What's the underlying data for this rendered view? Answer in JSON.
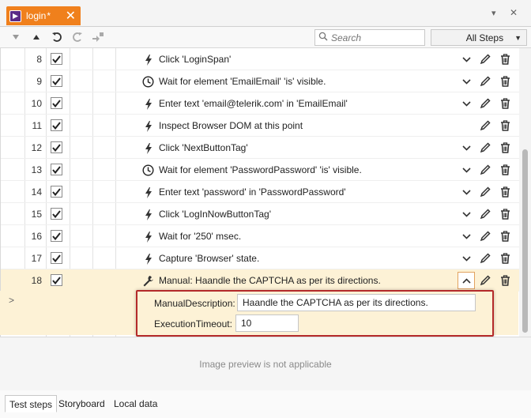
{
  "tab": {
    "title": "login",
    "modified_mark": "*"
  },
  "toolbar": {
    "search_placeholder": "Search",
    "filter_value": "All Steps"
  },
  "steps": [
    {
      "num": "8",
      "text": "Click 'LoginSpan'",
      "icon": "bolt-icon",
      "checked": true,
      "expandable": true
    },
    {
      "num": "9",
      "text": "Wait for element 'EmailEmail' 'is' visible.",
      "icon": "clock-icon",
      "checked": true,
      "expandable": true
    },
    {
      "num": "10",
      "text": "Enter text 'email@telerik.com' in 'EmailEmail'",
      "icon": "bolt-icon",
      "checked": true,
      "expandable": true
    },
    {
      "num": "11",
      "text": "Inspect Browser DOM at this point",
      "icon": "bolt-icon",
      "checked": true,
      "expandable": false
    },
    {
      "num": "12",
      "text": "Click 'NextButtonTag'",
      "icon": "bolt-icon",
      "checked": true,
      "expandable": true
    },
    {
      "num": "13",
      "text": "Wait for element 'PasswordPassword' 'is' visible.",
      "icon": "clock-icon",
      "checked": true,
      "expandable": true
    },
    {
      "num": "14",
      "text": "Enter text 'password' in 'PasswordPassword'",
      "icon": "bolt-icon",
      "checked": true,
      "expandable": true
    },
    {
      "num": "15",
      "text": "Click 'LogInNowButtonTag'",
      "icon": "bolt-icon",
      "checked": true,
      "expandable": true
    },
    {
      "num": "16",
      "text": "Wait for '250' msec.",
      "icon": "bolt-icon",
      "checked": true,
      "expandable": true
    },
    {
      "num": "17",
      "text": "Capture 'Browser' state.",
      "icon": "bolt-icon",
      "checked": true,
      "expandable": true
    },
    {
      "num": "18",
      "text": "Manual: Haandle the CAPTCHA as per its directions.",
      "icon": "wrench-icon",
      "checked": true,
      "expandable": true,
      "selected": true
    }
  ],
  "details": {
    "manual_description_label": "ManualDescription:",
    "manual_description_value": "Haandle the CAPTCHA as per its directions.",
    "execution_timeout_label": "ExecutionTimeout:",
    "execution_timeout_value": "10"
  },
  "preview": {
    "message": "Image preview is not applicable"
  },
  "bottom_tabs": [
    {
      "label": "Test steps",
      "active": true
    },
    {
      "label": "Storyboard",
      "active": false
    },
    {
      "label": "Local data",
      "active": false
    }
  ],
  "colors": {
    "accent": "#f0801c",
    "selected_row": "#fdf2d6",
    "highlight_border": "#b42a2a"
  }
}
